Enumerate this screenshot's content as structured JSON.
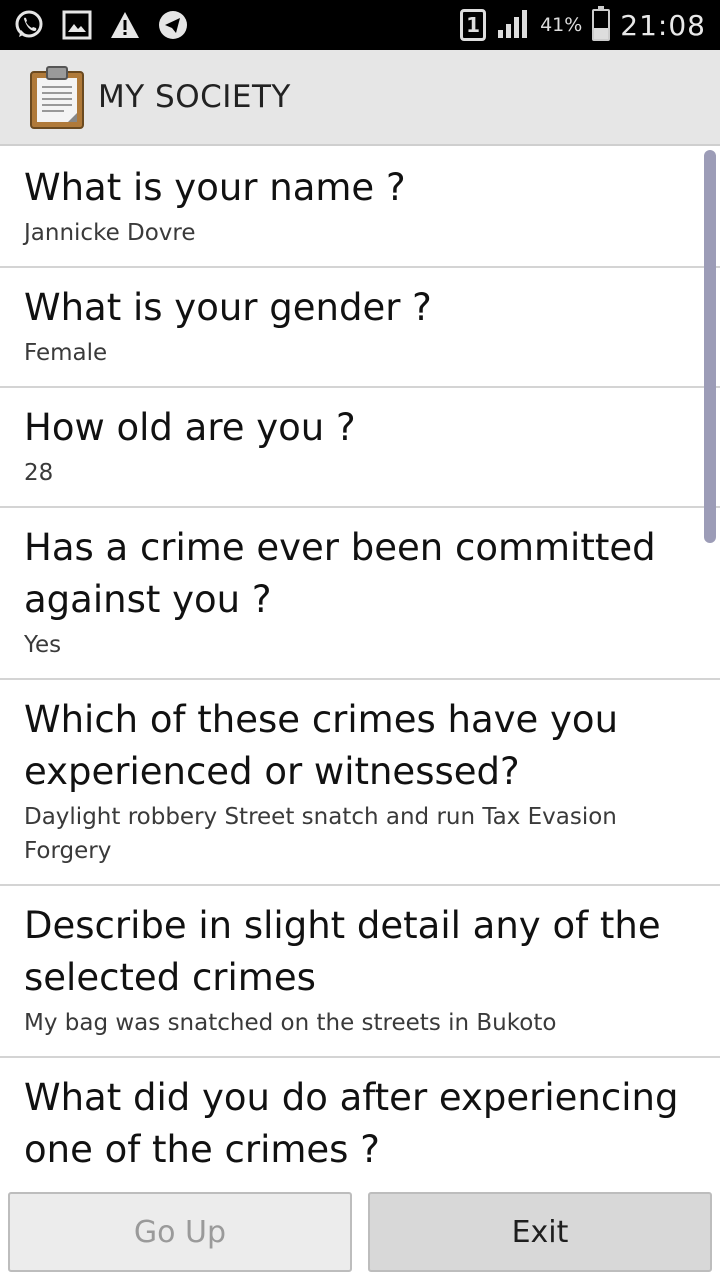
{
  "status_bar": {
    "icons": [
      "whatsapp-icon",
      "image-icon",
      "warning-icon",
      "telegram-icon"
    ],
    "sim": "1",
    "battery_percent": "41%",
    "battery_level": 0.41,
    "time": "21:08"
  },
  "app_bar": {
    "title": "MY SOCIETY",
    "icon": "clipboard-icon"
  },
  "items": [
    {
      "question": "What is your name ?",
      "answer": "Jannicke Dovre"
    },
    {
      "question": "What is your gender ?",
      "answer": "Female"
    },
    {
      "question": "How old are you ?",
      "answer": "28"
    },
    {
      "question": "Has a crime ever been committed against you ?",
      "answer": "Yes"
    },
    {
      "question": "Which of these crimes have you experienced or witnessed?",
      "answer": "Daylight robbery Street snatch and run Tax Evasion Forgery"
    },
    {
      "question": "Describe in slight detail any of the selected crimes",
      "answer": "My bag was snatched on the streets in Bukoto"
    },
    {
      "question": "What did you do after experiencing one of the crimes ?",
      "answer": ""
    }
  ],
  "buttons": {
    "go_up": "Go Up",
    "exit": "Exit"
  },
  "colors": {
    "action_bar": "#e6e6e6",
    "scrollbar": "#9c9cb7"
  }
}
